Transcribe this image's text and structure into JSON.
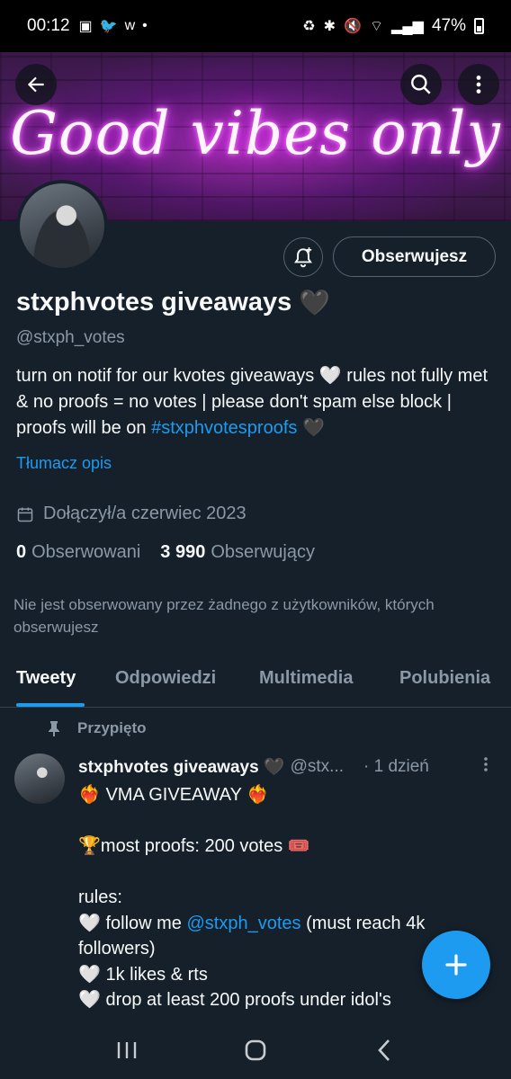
{
  "status_bar": {
    "time": "00:12",
    "battery": "47%"
  },
  "banner": {
    "neon_text": "Good vibes only"
  },
  "profile": {
    "name": "stxphvotes giveaways",
    "handle": "@stxph_votes",
    "follow_label": "Obserwujesz",
    "bio_text_1": "turn on notif for our kvotes giveaways 🤍 rules not fully met & no proofs = no votes | please don't spam else block |  proofs will be on ",
    "bio_hashtag": "#stxphvotesproofs",
    "bio_end": " 🖤",
    "translate_label": "Tłumacz opis",
    "joined": "Dołączył/a czerwiec 2023",
    "following_count": "0",
    "following_label": "Obserwowani",
    "followers_count": "3 990",
    "followers_label": "Obserwujący",
    "not_followed_notice": "Nie jest obserwowany przez żadnego z użytkowników, których obserwujesz"
  },
  "tabs": [
    {
      "label": "Tweety",
      "active": true
    },
    {
      "label": "Odpowiedzi",
      "active": false
    },
    {
      "label": "Multimedia",
      "active": false
    },
    {
      "label": "Polubienia",
      "active": false
    }
  ],
  "pinned_tweet": {
    "pinned_label": "Przypięto",
    "author_name": "stxphvotes giveaways 🖤",
    "author_handle": "@stx...",
    "time": "· 1 dzień",
    "line1": "❤️‍🔥 VMA GIVEAWAY ❤️‍🔥",
    "line2": "🏆most proofs: 200 votes 🎟️",
    "line3": "rules:",
    "line4a": "🤍 follow me ",
    "line4_mention": "@stxph_votes",
    "line4b": " (must reach 4k followers)",
    "line5": "🤍 1k likes & rts",
    "line6": "🤍 drop at least 200 proofs under idol's"
  },
  "colors": {
    "background": "#15202b",
    "accent": "#1d9bf0",
    "secondary_text": "#8b98a5"
  }
}
